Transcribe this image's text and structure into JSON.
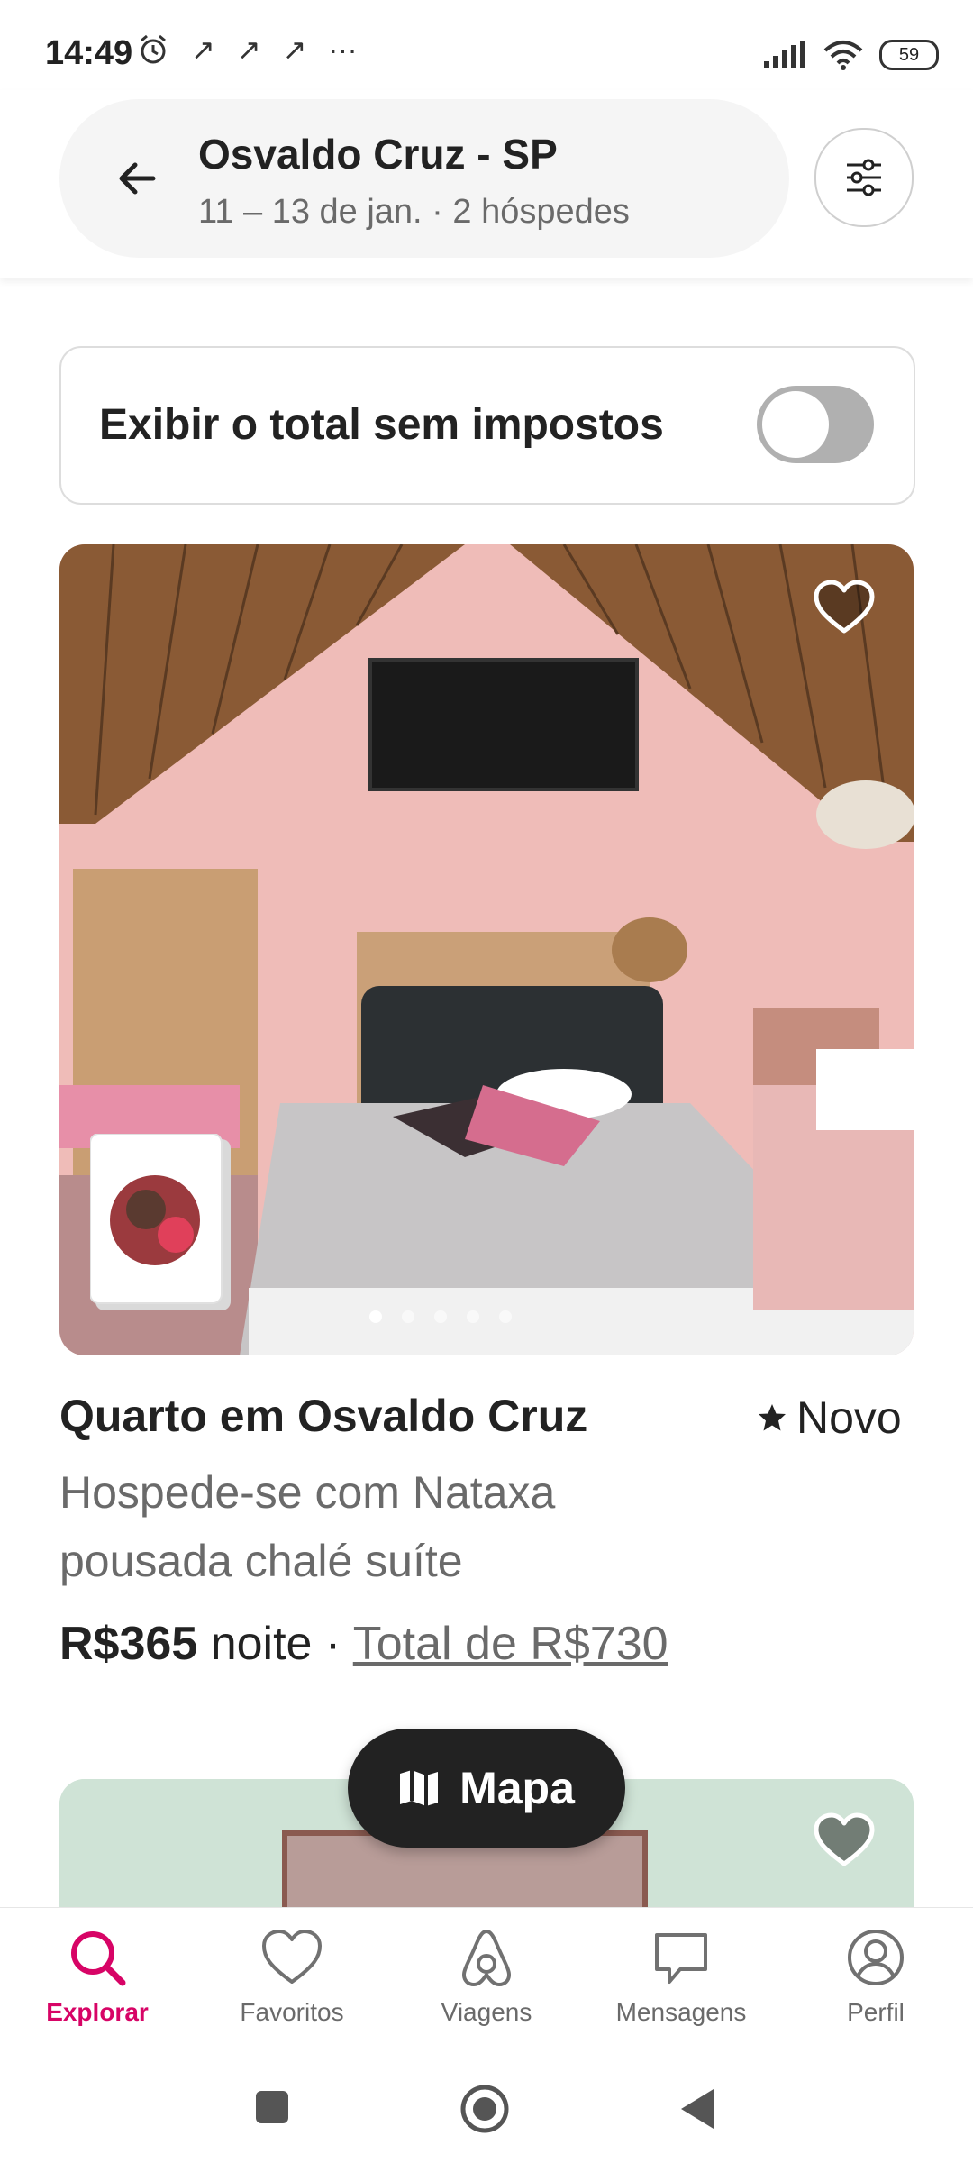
{
  "status_bar": {
    "time": "14:49",
    "battery": "59"
  },
  "search": {
    "location": "Osvaldo Cruz - SP",
    "details": "11 – 13 de jan. · 2 hóspedes"
  },
  "tax_toggle": {
    "label": "Exibir o total sem impostos",
    "enabled": false
  },
  "listing": {
    "title": "Quarto em Osvaldo Cruz",
    "rating": "Novo",
    "description": "Hospede-se com Nataxa pousada chalé suíte",
    "price": "R$365",
    "price_unit": "noite",
    "separator": "·",
    "total": "Total de R$730"
  },
  "map_button": {
    "label": "Mapa"
  },
  "bottom_nav": {
    "items": [
      {
        "label": "Explorar",
        "icon": "search-icon",
        "active": true
      },
      {
        "label": "Favoritos",
        "icon": "heart-icon",
        "active": false
      },
      {
        "label": "Viagens",
        "icon": "airbnb-logo-icon",
        "active": false
      },
      {
        "label": "Mensagens",
        "icon": "message-icon",
        "active": false
      },
      {
        "label": "Perfil",
        "icon": "profile-icon",
        "active": false
      }
    ]
  },
  "colors": {
    "accent": "#d70466",
    "text": "#222222",
    "muted": "#6a6a6a"
  }
}
